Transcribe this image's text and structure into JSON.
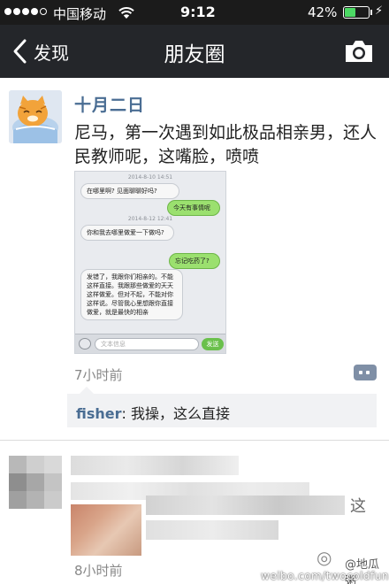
{
  "status_bar": {
    "carrier": "中国移动",
    "time": "9:12",
    "battery_percent": "42%",
    "battery_level": 0.42,
    "signal_bars_filled": 4,
    "signal_bars_total": 5
  },
  "nav": {
    "back_label": "发现",
    "title": "朋友圈",
    "camera_icon": "camera-icon"
  },
  "post1": {
    "author": "十月二日",
    "text": "尼马，第一次遇到如此极品相亲男，还人民教师呢，这嘴脸，喷喷",
    "time_ago": "7小时前",
    "image": {
      "date1": "2014-8-10 14:51",
      "msg1": "在哪里啊? 见面聊聊好吗?",
      "msg2": "今天有事情呢",
      "date2": "2014-8-12 12:41",
      "msg3": "你和我去哪里做爱一下做吗?",
      "msg4": "忘记吃药了?",
      "msg5": "发错了，我跟你们相亲的。不能这样直接。我跟那些做爱的天天这样做爱。但对不起，不能对你这样说。尽管我心里想跟你直接做爱，就是最快的相亲",
      "input_placeholder": "文本信息",
      "send_label": "发送"
    },
    "comments": [
      {
        "name": "fisher",
        "separator": ": ",
        "text": "我操，这么直接"
      }
    ]
  },
  "post2": {
    "time_ago": "8小时前",
    "partial_glyph": "这"
  },
  "watermark": {
    "name": "@地瓜粥",
    "url": "weibo.com/twocoldfun"
  },
  "colors": {
    "navbar": "#24262a",
    "link_blue": "#4a6d93",
    "bubble_green": "#9be06f",
    "battery_green": "#4cd964"
  }
}
